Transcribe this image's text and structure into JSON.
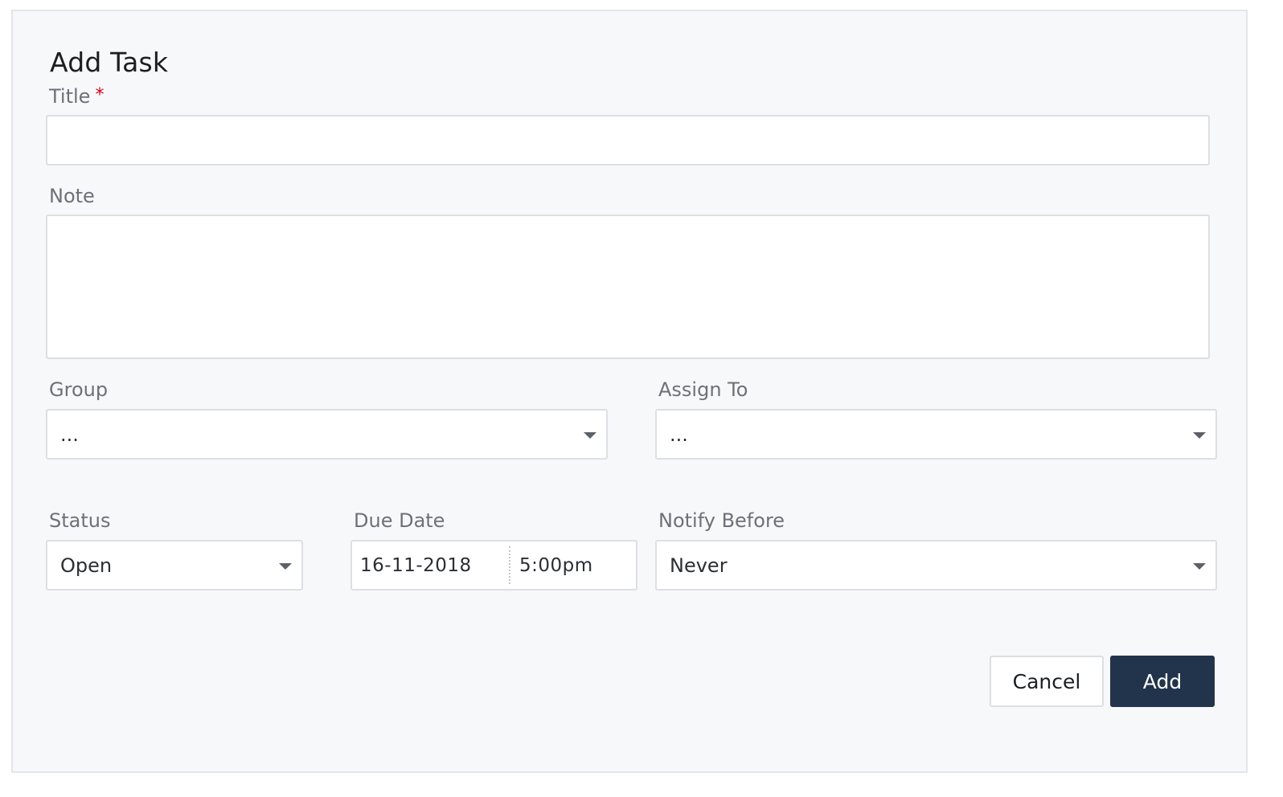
{
  "form": {
    "heading": "Add Task",
    "title": {
      "label": "Title",
      "required_marker": "*",
      "value": "",
      "placeholder": ""
    },
    "note": {
      "label": "Note",
      "value": "",
      "placeholder": ""
    },
    "group": {
      "label": "Group",
      "selected": "..."
    },
    "assign_to": {
      "label": "Assign To",
      "selected": "..."
    },
    "status": {
      "label": "Status",
      "selected": "Open"
    },
    "due_date": {
      "label": "Due Date",
      "date": "16-11-2018",
      "time": "5:00pm"
    },
    "notify_before": {
      "label": "Notify Before",
      "selected": "Never"
    }
  },
  "actions": {
    "cancel_label": "Cancel",
    "add_label": "Add"
  },
  "colors": {
    "panel_background": "#f7f8fa",
    "primary_button": "#22344b",
    "required_marker": "#d0021b"
  },
  "icons": {
    "dropdown": "chevron-down-icon"
  }
}
